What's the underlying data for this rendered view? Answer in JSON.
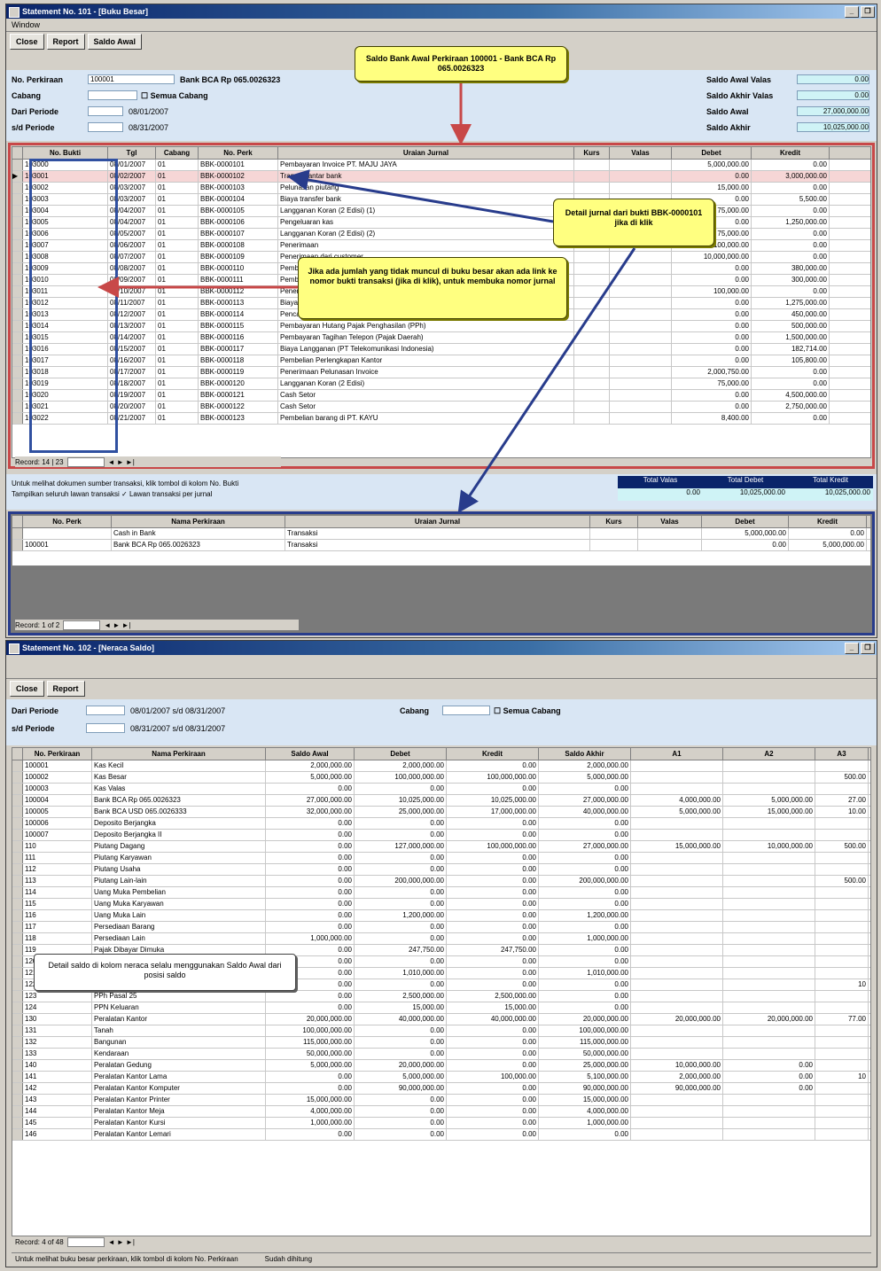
{
  "win1": {
    "title": "Statement No. 101 - [Buku Besar]",
    "menu": [
      "Window"
    ],
    "toolbar": [
      "Close",
      "Report",
      "Saldo Awal"
    ],
    "labels": {
      "no_perkiraan": "No. Perkiraan",
      "cabang": "Cabang",
      "dari_periode": "Dari Periode",
      "s_d_periode": "s/d Periode",
      "saldo_awal_valas": "Saldo Awal Valas",
      "saldo_akhir_valas": "Saldo Akhir Valas",
      "saldo_awal": "Saldo Awal",
      "saldo_akhir": "Saldo Akhir"
    },
    "fields": {
      "no_perkiraan": "100001",
      "nama_perkiraan": "Bank BCA Rp 065.0026323",
      "cabang": "",
      "semua_cabang": "Semua Cabang",
      "dari_periode_date": "08/01/2007",
      "sd_periode_date": "08/31/2007",
      "saldo_awal_valas": "0.00",
      "saldo_akhir_valas": "0.00",
      "saldo_awal": "27,000,000.00",
      "saldo_akhir": "10,025,000.00"
    },
    "grid_headers": [
      "No. Bukti",
      "Tgl",
      "Cabang",
      "No. Perk",
      "Uraian Jurnal",
      "Kurs",
      "Valas",
      "Debet",
      "Kredit"
    ],
    "grid_rows": [
      [
        "103000",
        "08/01/2007",
        "01",
        "BBK-0000101",
        "Pembayaran Invoice PT. MAJU JAYA",
        "",
        "",
        "5,000,000.00",
        "0.00"
      ],
      [
        "103001",
        "08/02/2007",
        "01",
        "BBK-0000102",
        "Transfer antar bank",
        "",
        "",
        "0.00",
        "3,000,000.00"
      ],
      [
        "103002",
        "08/03/2007",
        "01",
        "BBK-0000103",
        "Pelunasan piutang",
        "",
        "",
        "15,000.00",
        "0.00"
      ],
      [
        "103003",
        "08/03/2007",
        "01",
        "BBK-0000104",
        "Biaya transfer bank",
        "",
        "",
        "0.00",
        "5,500.00"
      ],
      [
        "103004",
        "08/04/2007",
        "01",
        "BBK-0000105",
        "Langganan Koran (2 Edisi) (1)",
        "",
        "",
        "75,000.00",
        "0.00"
      ],
      [
        "103005",
        "08/04/2007",
        "01",
        "BBK-0000106",
        "Pengeluaran kas",
        "",
        "",
        "0.00",
        "1,250,000.00"
      ],
      [
        "103006",
        "08/05/2007",
        "01",
        "BBK-0000107",
        "Langganan Koran (2 Edisi) (2)",
        "",
        "",
        "75,000.00",
        "0.00"
      ],
      [
        "103007",
        "08/06/2007",
        "01",
        "BBK-0000108",
        "Penerimaan",
        "",
        "",
        "100,000.00",
        "0.00"
      ],
      [
        "103008",
        "08/07/2007",
        "01",
        "BBK-0000109",
        "Penerimaan dari customer",
        "",
        "",
        "10,000,000.00",
        "0.00"
      ],
      [
        "103009",
        "08/08/2007",
        "01",
        "BBK-0000110",
        "Pembayaran supplier",
        "",
        "",
        "0.00",
        "380,000.00"
      ],
      [
        "103010",
        "08/09/2007",
        "01",
        "BBK-0000111",
        "Pembayaran",
        "",
        "",
        "0.00",
        "300,000.00"
      ],
      [
        "103011",
        "08/10/2007",
        "01",
        "BBK-0000112",
        "Penerimaan",
        "",
        "",
        "100,000.00",
        "0.00"
      ],
      [
        "103012",
        "08/11/2007",
        "01",
        "BBK-0000113",
        "Biaya",
        "",
        "",
        "0.00",
        "1,275,000.00"
      ],
      [
        "103013",
        "08/12/2007",
        "01",
        "BBK-0000114",
        "Pencairan cheque customer",
        "",
        "",
        "0.00",
        "450,000.00"
      ],
      [
        "103014",
        "08/13/2007",
        "01",
        "BBK-0000115",
        "Pembayaran Hutang Pajak Penghasilan (PPh)",
        "",
        "",
        "0.00",
        "500,000.00"
      ],
      [
        "103015",
        "08/14/2007",
        "01",
        "BBK-0000116",
        "Pembayaran Tagihan Telepon (Pajak Daerah)",
        "",
        "",
        "0.00",
        "1,500,000.00"
      ],
      [
        "103016",
        "08/15/2007",
        "01",
        "BBK-0000117",
        "Biaya Langganan (PT Telekomunikasi Indonesia)",
        "",
        "",
        "0.00",
        "182,714.00"
      ],
      [
        "103017",
        "08/16/2007",
        "01",
        "BBK-0000118",
        "Pembelian Perlengkapan Kantor",
        "",
        "",
        "0.00",
        "105,800.00"
      ],
      [
        "103018",
        "08/17/2007",
        "01",
        "BBK-0000119",
        "Penerimaan Pelunasan Invoice",
        "",
        "",
        "2,000,750.00",
        "0.00"
      ],
      [
        "103019",
        "08/18/2007",
        "01",
        "BBK-0000120",
        "Langganan Koran (2 Edisi)",
        "",
        "",
        "75,000.00",
        "0.00"
      ],
      [
        "103020",
        "08/19/2007",
        "01",
        "BBK-0000121",
        "Cash Setor",
        "",
        "",
        "0.00",
        "4,500,000.00"
      ],
      [
        "103021",
        "08/20/2007",
        "01",
        "BBK-0000122",
        "Cash Setor",
        "",
        "",
        "0.00",
        "2,750,000.00"
      ],
      [
        "103022",
        "08/21/2007",
        "01",
        "BBK-0000123",
        "Pembelian barang di PT. KAYU",
        "",
        "",
        "8,400.00",
        "0.00"
      ]
    ],
    "nav_label": "Record: 14 | 23",
    "info_line1": "Untuk melihat dokumen sumber transaksi, klik tombol di kolom No. Bukti",
    "info_line2": "Tampilkan seluruh lawan transaksi  ✓  Lawan transaksi per jurnal",
    "totals_headers": [
      "Total Valas",
      "Total Debet",
      "Total Kredit"
    ],
    "totals_values": [
      "0.00",
      "10,025,000.00",
      "10,025,000.00"
    ],
    "detail_headers": [
      "No. Perk",
      "Nama Perkiraan",
      "Uraian Jurnal",
      "Kurs",
      "Valas",
      "Debet",
      "Kredit"
    ],
    "detail_rows": [
      [
        "",
        "Cash in Bank",
        "Transaksi",
        "",
        "",
        "5,000,000.00",
        "0.00"
      ],
      [
        "100001",
        "Bank BCA Rp 065.0026323",
        "Transaksi",
        "",
        "",
        "0.00",
        "5,000,000.00"
      ]
    ],
    "detail_nav": "Record: 1 of 2"
  },
  "callouts": {
    "top": "Saldo Bank Awal Perkiraan 100001 - Bank BCA Rp 065.0026323",
    "right": "Detail jurnal dari bukti BBK-0000101 jika di klik",
    "middle": "Jika ada jumlah yang tidak muncul di buku besar akan ada link ke nomor bukti transaksi (jika di klik), untuk membuka nomor jurnal",
    "bottom": "Detail saldo di kolom neraca selalu menggunakan Saldo Awal dari posisi saldo"
  },
  "win2": {
    "title": "Statement No. 102 - [Neraca Saldo]",
    "toolbar": [
      "Close",
      "Report"
    ],
    "labels": {
      "dari_periode": "Dari Periode",
      "s_d_periode": "s/d Periode",
      "cabang": "Cabang"
    },
    "fields": {
      "dari_periode": "08/01/2007  s/d  08/31/2007",
      "sd_periode": "08/31/2007  s/d  08/31/2007",
      "cabang": "",
      "semua_cabang": "Semua Cabang"
    },
    "grid_headers": [
      "No. Perkiraan",
      "Nama Perkiraan",
      "Saldo Awal",
      "Debet",
      "Kredit",
      "Saldo Akhir",
      "A1",
      "A2",
      "A3"
    ],
    "grid_rows": [
      [
        "100001",
        "Kas Kecil",
        "2,000,000.00",
        "2,000,000.00",
        "0.00",
        "2,000,000.00",
        "",
        "",
        ""
      ],
      [
        "100002",
        "Kas Besar",
        "5,000,000.00",
        "100,000,000.00",
        "100,000,000.00",
        "5,000,000.00",
        "",
        "",
        "500.00"
      ],
      [
        "100003",
        "Kas Valas",
        "0.00",
        "0.00",
        "0.00",
        "0.00",
        "",
        "",
        ""
      ],
      [
        "100004",
        "Bank BCA Rp 065.0026323",
        "27,000,000.00",
        "10,025,000.00",
        "10,025,000.00",
        "27,000,000.00",
        "4,000,000.00",
        "5,000,000.00",
        "27.00"
      ],
      [
        "100005",
        "Bank BCA USD 065.0026333",
        "32,000,000.00",
        "25,000,000.00",
        "17,000,000.00",
        "40,000,000.00",
        "5,000,000.00",
        "15,000,000.00",
        "10.00"
      ],
      [
        "100006",
        "Deposito Berjangka",
        "0.00",
        "0.00",
        "0.00",
        "0.00",
        "",
        "",
        ""
      ],
      [
        "100007",
        "Deposito Berjangka II",
        "0.00",
        "0.00",
        "0.00",
        "0.00",
        "",
        "",
        ""
      ],
      [
        "110",
        "Piutang Dagang",
        "0.00",
        "127,000,000.00",
        "100,000,000.00",
        "27,000,000.00",
        "15,000,000.00",
        "10,000,000.00",
        "500.00"
      ],
      [
        "111",
        "Piutang Karyawan",
        "0.00",
        "0.00",
        "0.00",
        "0.00",
        "",
        "",
        ""
      ],
      [
        "112",
        "Piutang Usaha",
        "0.00",
        "0.00",
        "0.00",
        "0.00",
        "",
        "",
        ""
      ],
      [
        "113",
        "Piutang Lain-lain",
        "0.00",
        "200,000,000.00",
        "0.00",
        "200,000,000.00",
        "",
        "",
        "500.00"
      ],
      [
        "114",
        "Uang Muka Pembelian",
        "0.00",
        "0.00",
        "0.00",
        "0.00",
        "",
        "",
        ""
      ],
      [
        "115",
        "Uang Muka Karyawan",
        "0.00",
        "0.00",
        "0.00",
        "0.00",
        "",
        "",
        ""
      ],
      [
        "116",
        "Uang Muka Lain",
        "0.00",
        "1,200,000.00",
        "0.00",
        "1,200,000.00",
        "",
        "",
        ""
      ],
      [
        "117",
        "Persediaan Barang",
        "0.00",
        "0.00",
        "0.00",
        "0.00",
        "",
        "",
        ""
      ],
      [
        "118",
        "Persediaan Lain",
        "1,000,000.00",
        "0.00",
        "0.00",
        "1,000,000.00",
        "",
        "",
        ""
      ],
      [
        "119",
        "Pajak Dibayar Dimuka",
        "0.00",
        "247,750.00",
        "247,750.00",
        "0.00",
        "",
        "",
        ""
      ],
      [
        "120",
        "PPN Masukan",
        "0.00",
        "0.00",
        "0.00",
        "0.00",
        "",
        "",
        ""
      ],
      [
        "121",
        "PPh 21 Dibayar Dimuka",
        "0.00",
        "1,010,000.00",
        "0.00",
        "1,010,000.00",
        "",
        "",
        ""
      ],
      [
        "122",
        "PPh 23 Dibayar Dimuka",
        "0.00",
        "0.00",
        "0.00",
        "0.00",
        "",
        "",
        "10"
      ],
      [
        "123",
        "PPh Pasal 25",
        "0.00",
        "2,500,000.00",
        "2,500,000.00",
        "0.00",
        "",
        "",
        ""
      ],
      [
        "124",
        "PPN Keluaran",
        "0.00",
        "15,000.00",
        "15,000.00",
        "0.00",
        "",
        "",
        ""
      ],
      [
        "130",
        "Peralatan Kantor",
        "20,000,000.00",
        "40,000,000.00",
        "40,000,000.00",
        "20,000,000.00",
        "20,000,000.00",
        "20,000,000.00",
        "77.00"
      ],
      [
        "131",
        "Tanah",
        "100,000,000.00",
        "0.00",
        "0.00",
        "100,000,000.00",
        "",
        "",
        ""
      ],
      [
        "132",
        "Bangunan",
        "115,000,000.00",
        "0.00",
        "0.00",
        "115,000,000.00",
        "",
        "",
        ""
      ],
      [
        "133",
        "Kendaraan",
        "50,000,000.00",
        "0.00",
        "0.00",
        "50,000,000.00",
        "",
        "",
        ""
      ],
      [
        "140",
        "Peralatan Gedung",
        "5,000,000.00",
        "20,000,000.00",
        "0.00",
        "25,000,000.00",
        "10,000,000.00",
        "0.00",
        ""
      ],
      [
        "141",
        "Peralatan Kantor Lama",
        "0.00",
        "5,000,000.00",
        "100,000.00",
        "5,100,000.00",
        "2,000,000.00",
        "0.00",
        "10"
      ],
      [
        "142",
        "Peralatan Kantor Komputer",
        "0.00",
        "90,000,000.00",
        "0.00",
        "90,000,000.00",
        "90,000,000.00",
        "0.00",
        ""
      ],
      [
        "143",
        "Peralatan Kantor Printer",
        "15,000,000.00",
        "0.00",
        "0.00",
        "15,000,000.00",
        "",
        "",
        ""
      ],
      [
        "144",
        "Peralatan Kantor Meja",
        "4,000,000.00",
        "0.00",
        "0.00",
        "4,000,000.00",
        "",
        "",
        ""
      ],
      [
        "145",
        "Peralatan Kantor Kursi",
        "1,000,000.00",
        "0.00",
        "0.00",
        "1,000,000.00",
        "",
        "",
        ""
      ],
      [
        "146",
        "Peralatan Kantor Lemari",
        "0.00",
        "0.00",
        "0.00",
        "0.00",
        "",
        "",
        ""
      ]
    ],
    "nav_label": "Record: 4 of 48",
    "status_left": "Untuk melihat buku besar perkiraan, klik tombol di kolom No. Perkiraan",
    "status_right": "Sudah dihitung"
  }
}
